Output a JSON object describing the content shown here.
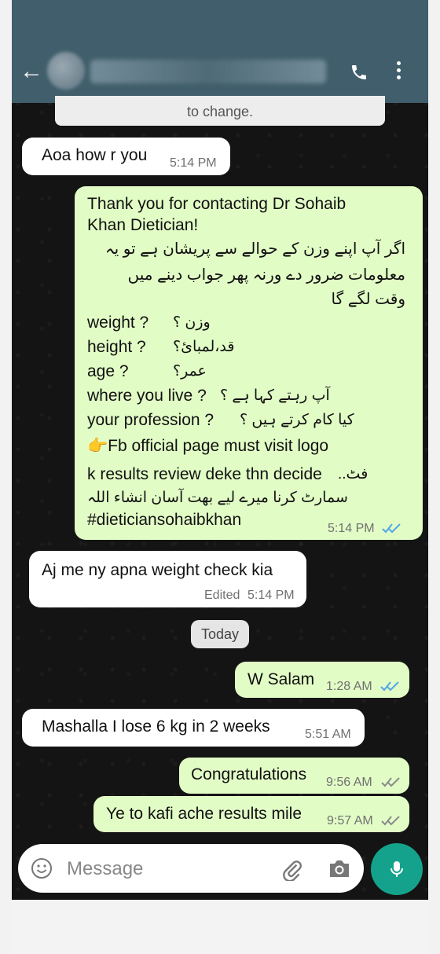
{
  "system_notice": "to change.",
  "header": {
    "back_icon": "back-arrow-icon",
    "call_icon": "phone-icon",
    "menu_icon": "more-vertical-icon"
  },
  "messages": [
    {
      "dir": "in",
      "text": "Aoa how r you",
      "time": "5:14 PM"
    },
    {
      "dir": "out",
      "lines": [
        "Thank you for contacting Dr Sohaib",
        "Khan Dietician!",
        "اگر آپ اپنے وزن کے حوالے سے پریشان ہے تو یہ",
        "معلومات ضرور دے ورنہ پھر جواب دینے میں",
        "وقت لگے گا",
        "weight ?",
        "وزن ؟",
        "height ?",
        "قد،لمبائ؟",
        "age  ?",
        "عمر؟",
        "where you live ?",
        "آپ رہتے کہا ہے ؟",
        "your profession ?",
        "کیا کام کرتے ہیں ؟",
        "👉Fb official page must visit logo",
        "k results review deke thn decide",
        "فٹ..",
        "سمارٹ کرنا میرے لیے بھت آسان انشاء اللہ",
        "#dieticiansohaibkhan"
      ],
      "time": "5:14 PM"
    },
    {
      "dir": "in",
      "text": "Aj me ny apna weight check  kia",
      "edited": "Edited",
      "time": "5:14 PM"
    },
    {
      "dir": "out",
      "text": "W Salam",
      "time": "1:28 AM"
    },
    {
      "dir": "in",
      "text": "Mashalla I lose 6 kg in 2 weeks",
      "time": "5:51 AM"
    },
    {
      "dir": "out",
      "text": "Congratulations",
      "time": "9:56 AM"
    },
    {
      "dir": "out",
      "text": "Ye to kafi ache results mile",
      "time": "9:57 AM"
    }
  ],
  "date_divider": "Today",
  "composer": {
    "placeholder": "Message",
    "emoji_icon": "emoji-icon",
    "attach_icon": "paperclip-icon",
    "camera_icon": "camera-icon",
    "mic_icon": "microphone-icon"
  },
  "colors": {
    "header": "#415e6c",
    "incoming": "#ffffff",
    "outgoing": "#e2fcc6",
    "accent": "#15a28c",
    "read_tick": "#4fa6e8",
    "sent_tick": "#8a8a8a"
  }
}
